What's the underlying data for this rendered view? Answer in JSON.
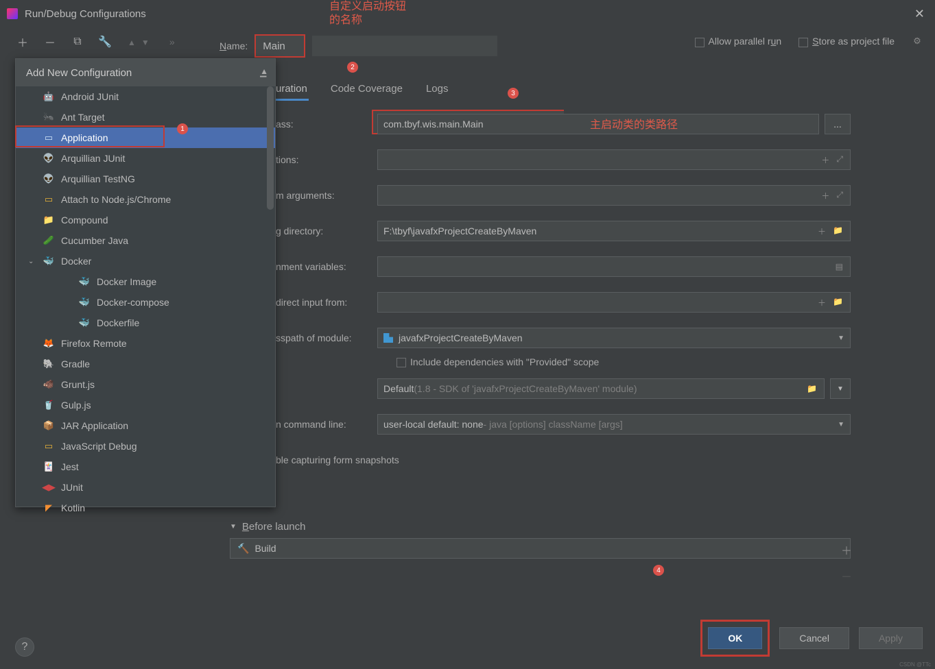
{
  "window": {
    "title": "Run/Debug Configurations"
  },
  "toolbar": {
    "name_label": "Name:",
    "name_value": "Main",
    "allow_parallel": "Allow parallel run",
    "store_as_project": "Store as project file"
  },
  "annotations": {
    "top_line1": "自定义启动按钮",
    "top_line2": "的名称",
    "main_class_hint": "主启动类的类路径",
    "badge1": "1",
    "badge2": "2",
    "badge3": "3",
    "badge4": "4"
  },
  "popup": {
    "header": "Add New Configuration",
    "items": [
      {
        "label": "Android JUnit",
        "icon": "🤖",
        "color": "#97c23c"
      },
      {
        "label": "Ant Target",
        "icon": "🐜",
        "color": "#888"
      },
      {
        "label": "Application",
        "icon": "▭",
        "color": "#cfe3f7",
        "selected": true
      },
      {
        "label": "Arquillian JUnit",
        "icon": "👽",
        "color": "#ccc"
      },
      {
        "label": "Arquillian TestNG",
        "icon": "👽",
        "color": "#ccc"
      },
      {
        "label": "Attach to Node.js/Chrome",
        "icon": "▭",
        "color": "#e8b339"
      },
      {
        "label": "Compound",
        "icon": "📁",
        "color": "#8aa76f"
      },
      {
        "label": "Cucumber Java",
        "icon": "🥒",
        "color": "#62b14b"
      },
      {
        "label": "Docker",
        "icon": "🐳",
        "color": "#3a96d1",
        "expandable": true,
        "expanded": true
      },
      {
        "label": "Docker Image",
        "icon": "🐳",
        "color": "#3a96d1",
        "sub": true
      },
      {
        "label": "Docker-compose",
        "icon": "🐳",
        "color": "#3a96d1",
        "sub": true
      },
      {
        "label": "Dockerfile",
        "icon": "🐳",
        "color": "#3a96d1",
        "sub": true
      },
      {
        "label": "Firefox Remote",
        "icon": "🦊",
        "color": "#e66000"
      },
      {
        "label": "Gradle",
        "icon": "🐘",
        "color": "#8a9a5b"
      },
      {
        "label": "Grunt.js",
        "icon": "🐗",
        "color": "#e48632"
      },
      {
        "label": "Gulp.js",
        "icon": "🥤",
        "color": "#cf4647"
      },
      {
        "label": "JAR Application",
        "icon": "📦",
        "color": "#7aa0c4"
      },
      {
        "label": "JavaScript Debug",
        "icon": "▭",
        "color": "#e8b339"
      },
      {
        "label": "Jest",
        "icon": "🃏",
        "color": "#c21f5b"
      },
      {
        "label": "JUnit",
        "icon": "◀▶",
        "color": "#cf4647"
      },
      {
        "label": "Kotlin",
        "icon": "◤",
        "color": "#f18e33"
      }
    ]
  },
  "tabs": {
    "configuration": "uration",
    "coverage": "Code Coverage",
    "logs": "Logs"
  },
  "form": {
    "main_class_label": "ass:",
    "main_class_value": "com.tbyf.wis.main.Main",
    "vm_options_label": "tions:",
    "prog_args_label": "m arguments:",
    "work_dir_label": "g directory:",
    "work_dir_value": "F:\\tbyf\\javafxProjectCreateByMaven",
    "env_vars_label": "nment variables:",
    "redirect_label": "direct input from:",
    "classpath_label": "sspath of module:",
    "classpath_value": "javafxProjectCreateByMaven",
    "include_provided": "Include dependencies with \"Provided\" scope",
    "jre_label": "",
    "jre_value_primary": "Default",
    "jre_value_hint": " (1.8 - SDK of 'javafxProjectCreateByMaven' module)",
    "shorten_label": "n command line:",
    "shorten_value": "user-local default: none",
    "shorten_hint": " - java [options] className [args]",
    "snapshot_label": "ble capturing form snapshots"
  },
  "before_launch": {
    "header": "Before launch",
    "item": "Build"
  },
  "buttons": {
    "ok": "OK",
    "cancel": "Cancel",
    "apply": "Apply"
  },
  "watermark": "CSDN @TTc"
}
